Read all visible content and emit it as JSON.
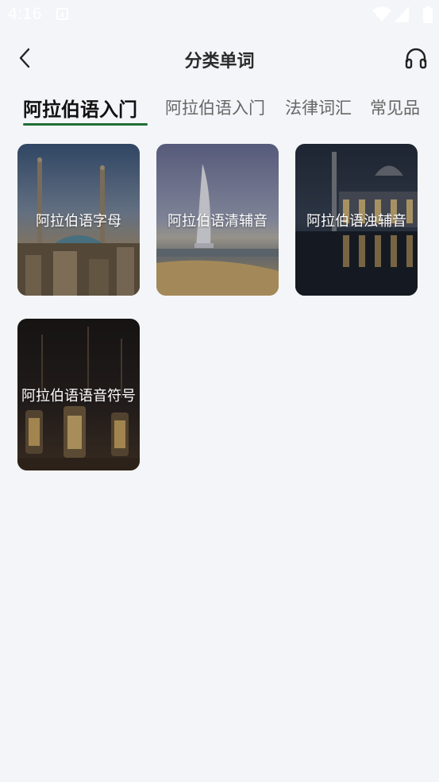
{
  "status_bar": {
    "time": "4:16"
  },
  "header": {
    "title": "分类单词"
  },
  "tabs": [
    {
      "label": "阿拉伯语入门",
      "active": true
    },
    {
      "label": "阿拉伯语入门",
      "active": false
    },
    {
      "label": "法律词汇",
      "active": false
    },
    {
      "label": "常见品",
      "active": false
    }
  ],
  "categories": [
    {
      "label": "阿拉伯语字母"
    },
    {
      "label": "阿拉伯语清辅音"
    },
    {
      "label": "阿拉伯语浊辅音"
    },
    {
      "label": "阿拉伯语语音符号"
    }
  ],
  "colors": {
    "accent": "#1f6d35",
    "background": "#f4f5f8"
  },
  "icons": {
    "back": "chevron-left-icon",
    "audio": "headphones-icon"
  }
}
